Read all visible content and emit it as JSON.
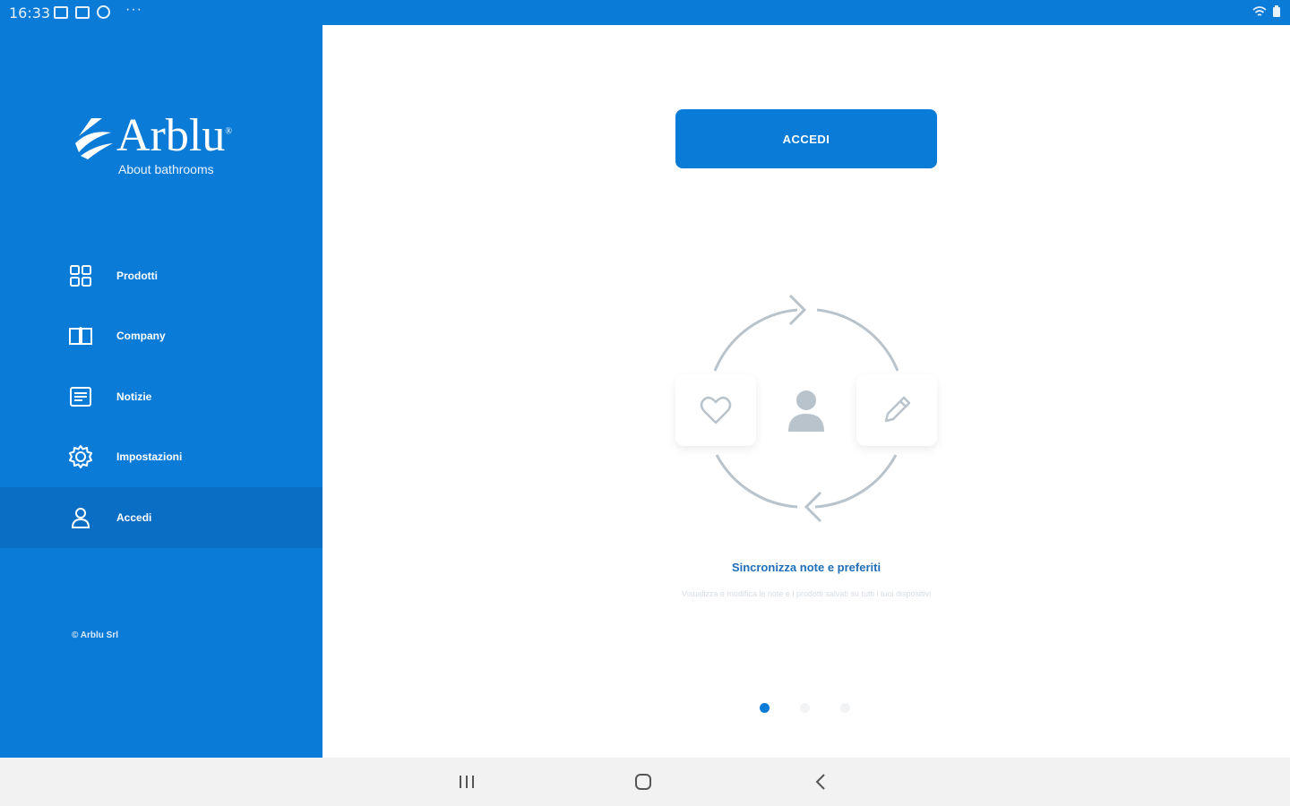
{
  "status_bar": {
    "time": "16:33"
  },
  "sidebar": {
    "brand": {
      "name": "Arblu",
      "tagline": "About bathrooms"
    },
    "items": [
      {
        "label": "Prodotti",
        "icon": "grid-icon"
      },
      {
        "label": "Company",
        "icon": "book-icon"
      },
      {
        "label": "Notizie",
        "icon": "news-icon"
      },
      {
        "label": "Impostazioni",
        "icon": "gear-icon"
      },
      {
        "label": "Accedi",
        "icon": "user-icon",
        "active": true
      }
    ],
    "copyright": "© Arblu Srl"
  },
  "main": {
    "login_button": "ACCEDI",
    "slide": {
      "title": "Sincronizza note e preferiti",
      "description": "Visualizza e modifica le note e i prodotti salvati su tutti i tuoi dispositivi",
      "icons": [
        "heart-icon",
        "user-icon",
        "pencil-icon",
        "sync-arrows-icon"
      ]
    },
    "pager": {
      "count": 3,
      "current": 1
    }
  },
  "colors": {
    "brand_blue": "#0b7bd8",
    "active_item": "#0a6ec4",
    "slide_title": "#1f6fb8",
    "illustration_gray": "#b9c3cb"
  }
}
